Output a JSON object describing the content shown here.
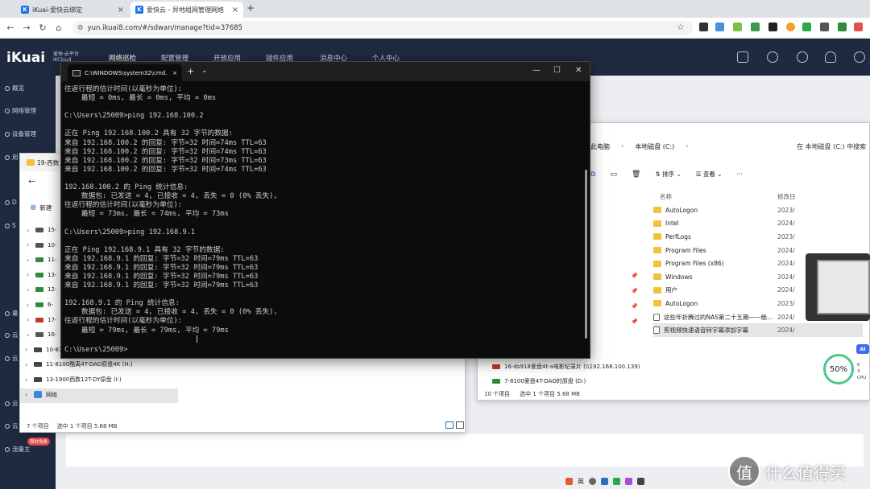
{
  "browser": {
    "tabs": [
      {
        "title": "iKuai-爱快云绑定",
        "icon": "ikuai-favicon"
      },
      {
        "title": "爱快云 - 异地组网管理网络",
        "icon": "ikuai-favicon"
      }
    ],
    "new_tab": "+",
    "url": "yun.ikuai8.com/#/sdwan/manage?tid=37685"
  },
  "app": {
    "logo": "iKuai",
    "logo_sub1": "爱快·云平台",
    "logo_sub2": "iKCloud",
    "nav": [
      "网络巡检",
      "配置管理",
      "开放应用",
      "插件应用",
      "消息中心",
      "个人中心"
    ],
    "active_nav": "网络巡检",
    "sidebar": [
      "概览",
      "网络管理",
      "设备管理",
      "用",
      "D",
      "S",
      "量",
      "云",
      "云",
      "云",
      "云"
    ],
    "flow_badge": "流量主",
    "flow_badge_tag": "限时免费"
  },
  "explorer_left": {
    "tab_title": "19-西数",
    "new_label": "新建",
    "tree": [
      {
        "label": "15-",
        "type": "drive"
      },
      {
        "label": "10-",
        "type": "drive"
      },
      {
        "label": "11-",
        "type": "drive"
      },
      {
        "label": "13-",
        "type": "drive"
      },
      {
        "label": "12-",
        "type": "drive"
      },
      {
        "label": "6-",
        "type": "drive"
      },
      {
        "label": "17-",
        "type": "drive"
      },
      {
        "label": "16-",
        "type": "drive"
      },
      {
        "label": "10-87",
        "type": "drive"
      },
      {
        "label": "11-8100酷禹4T-DAO原盘4K (H:)",
        "type": "drive"
      },
      {
        "label": "13-1900西数12T-DY原盘 (I:)",
        "type": "drive"
      },
      {
        "label": "网络",
        "type": "network"
      }
    ],
    "status_items": "7 个项目",
    "status_selected": "选中 1 个项目  5.68 MB"
  },
  "explorer_right": {
    "crumbs": [
      "此电脑",
      "本地磁盘 (C:)"
    ],
    "search_placeholder": "在 本地磁盘 (C:) 中搜索",
    "sort_label": "排序",
    "view_label": "查看",
    "more": "···",
    "col_name": "名称",
    "col_date": "修改日",
    "files": [
      {
        "name": "AutoLogon",
        "date": "2023/",
        "type": "folder"
      },
      {
        "name": "Intel",
        "date": "2024/",
        "type": "folder"
      },
      {
        "name": "PerfLogs",
        "date": "2023/",
        "type": "folder"
      },
      {
        "name": "Program Files",
        "date": "2024/",
        "type": "folder"
      },
      {
        "name": "Program Files (x86)",
        "date": "2024/",
        "type": "folder"
      },
      {
        "name": "Windows",
        "date": "2024/",
        "type": "folder"
      },
      {
        "name": "用户",
        "date": "2024/",
        "type": "folder"
      },
      {
        "name": "AutoLogon",
        "date": "2023/",
        "type": "folder"
      },
      {
        "name": "这些年折腾过的NAS第二十五期——绝...",
        "date": "2024/",
        "type": "file"
      },
      {
        "name": "剪视频快速语音转字幕添加字幕",
        "date": "2024/",
        "type": "file",
        "selected": true
      }
    ],
    "nav_items": [
      {
        "label": "16-ds918爱盘4t-a电影纪录片 (\\\\192.168.100.139)",
        "type": "network"
      },
      {
        "label": "7-8100爱盘4T-DAO的原盘 (D:)",
        "type": "drive"
      }
    ],
    "status_items": "10 个项目",
    "status_selected": "选中 1 个项目  5.68 MB"
  },
  "cmd": {
    "tab_title": "C:\\WINDOWS\\system32\\cmd.",
    "lines": [
      "往返行程的估计时间(以毫秒为单位):",
      "    最短 = 0ms, 最长 = 0ms, 平均 = 0ms",
      "",
      "C:\\Users\\25009>ping 192.168.100.2",
      "",
      "正在 Ping 192.168.100.2 具有 32 字节的数据:",
      "来自 192.168.100.2 的回复: 字节=32 时间=74ms TTL=63",
      "来自 192.168.100.2 的回复: 字节=32 时间=74ms TTL=63",
      "来自 192.168.100.2 的回复: 字节=32 时间=73ms TTL=63",
      "来自 192.168.100.2 的回复: 字节=32 时间=74ms TTL=63",
      "",
      "192.168.100.2 的 Ping 统计信息:",
      "    数据包: 已发送 = 4, 已接收 = 4, 丢失 = 0 (0% 丢失),",
      "往返行程的估计时间(以毫秒为单位):",
      "    最短 = 73ms, 最长 = 74ms, 平均 = 73ms",
      "",
      "C:\\Users\\25009>ping 192.168.9.1",
      "",
      "正在 Ping 192.168.9.1 具有 32 字节的数据:",
      "来自 192.168.9.1 的回复: 字节=32 时间=79ms TTL=63",
      "来自 192.168.9.1 的回复: 字节=32 时间=79ms TTL=63",
      "来自 192.168.9.1 的回复: 字节=32 时间=79ms TTL=63",
      "来自 192.168.9.1 的回复: 字节=32 时间=79ms TTL=63",
      "",
      "192.168.9.1 的 Ping 统计信息:",
      "    数据包: 已发送 = 4, 已接收 = 4, 丢失 = 0 (0% 丢失),",
      "往返行程的估计时间(以毫秒为单位):",
      "    最短 = 79ms, 最长 = 79ms, 平均 = 79ms",
      "",
      "C:\\Users\\25009>"
    ]
  },
  "widgets": {
    "meter_value": "50%",
    "ai_label": "AI",
    "net_up": "0",
    "net_down": "3",
    "cpu_label": "CPU",
    "ime_label": "英",
    "watermark_icon": "值",
    "watermark_text": "什么值得买"
  },
  "colors": {
    "app_header": "#1f2940",
    "accent": "#3d8cff",
    "terminal_bg": "#0c0c0c",
    "terminal_fg": "#cccccc"
  }
}
